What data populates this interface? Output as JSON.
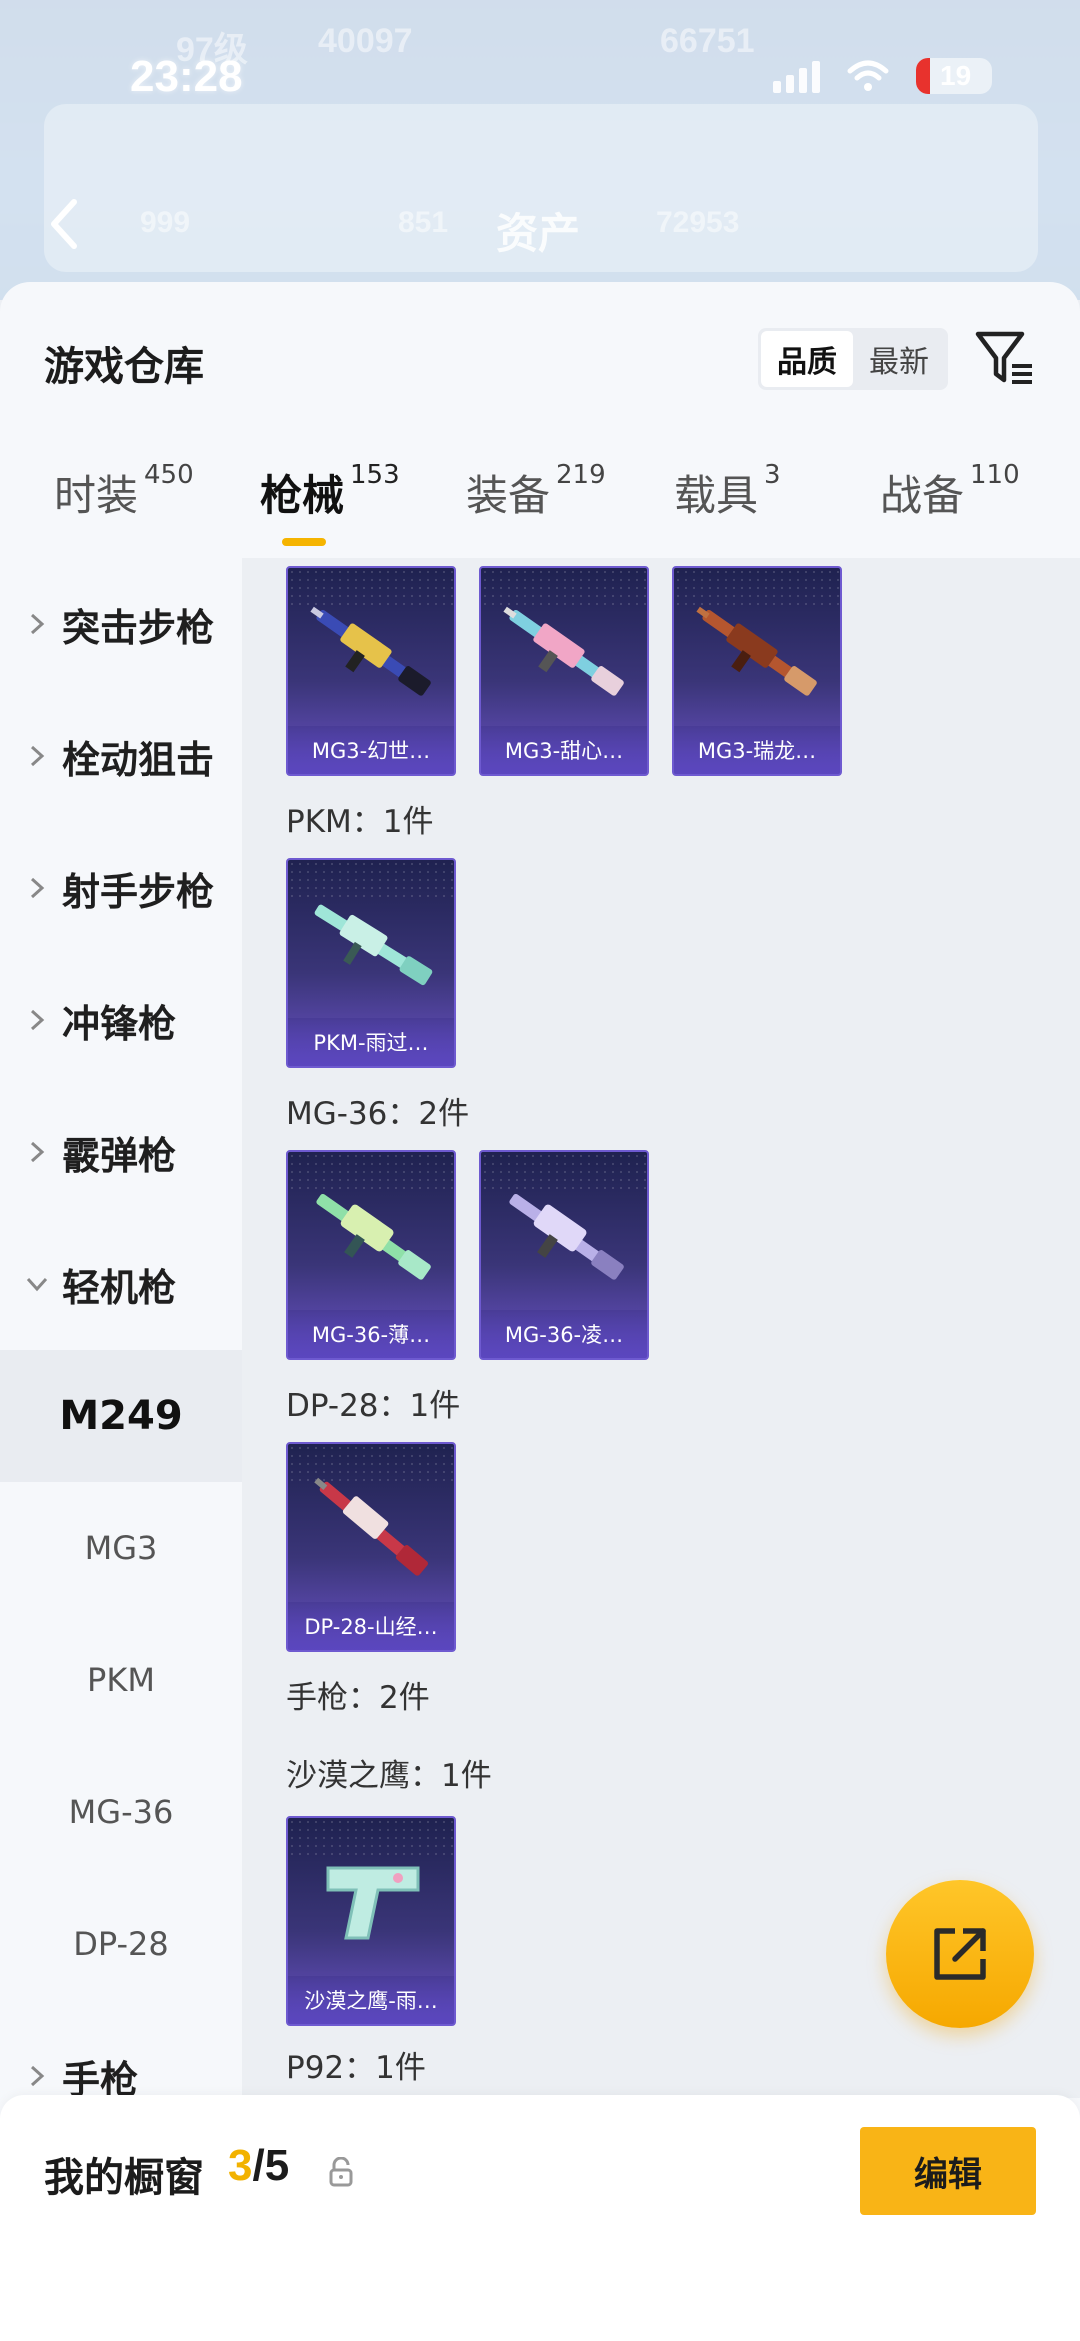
{
  "status_bar": {
    "time": "23:28",
    "battery": "19"
  },
  "header_bg": {
    "level": "97级",
    "coins": "40097",
    "points": "66751",
    "stat1": "999",
    "stat2": "851",
    "stat3": "72953",
    "title": "资产"
  },
  "panel": {
    "title": "游戏仓库",
    "sort_options": [
      "品质",
      "最新"
    ],
    "sort_active": "品质"
  },
  "tabs": [
    {
      "label": "时装",
      "count": "450"
    },
    {
      "label": "枪械",
      "count": "153"
    },
    {
      "label": "装备",
      "count": "219"
    },
    {
      "label": "载具",
      "count": "3"
    },
    {
      "label": "战备",
      "count": "110"
    }
  ],
  "active_tab": "枪械",
  "sidebar": {
    "categories": [
      "突击步枪",
      "栓动狙击",
      "射手步枪",
      "冲锋枪",
      "霰弹枪",
      "轻机枪"
    ],
    "expanded": "轻机枪",
    "subitems": [
      "M249",
      "MG3",
      "PKM",
      "MG-36",
      "DP-28"
    ],
    "active_sub": "M249",
    "last_category": "手枪"
  },
  "content": {
    "cards_row1": [
      "MG3-幻世…",
      "MG3-甜心…",
      "MG3-瑞龙…"
    ],
    "group_pkm": "PKM：1件",
    "cards_pkm": [
      "PKM-雨过…"
    ],
    "group_mg36": "MG-36：2件",
    "cards_mg36": [
      "MG-36-薄…",
      "MG-36-凌…"
    ],
    "group_dp28": "DP-28：1件",
    "cards_dp28": [
      "DP-28-山经…"
    ],
    "group_pistol": "手枪：2件",
    "group_deagle": "沙漠之鹰：1件",
    "cards_deagle": [
      "沙漠之鹰-雨…"
    ],
    "group_p92": "P92：1件"
  },
  "bottom": {
    "label": "我的橱窗",
    "current": "3",
    "separator": "/5",
    "edit": "编辑"
  },
  "colors": {
    "accent": "#f9b416",
    "card_purple": "#6a52c6"
  },
  "icons": [
    "chevron-right-icon",
    "chevron-down-icon",
    "filter-icon",
    "share-icon",
    "lock-icon",
    "back-arrow-icon"
  ]
}
